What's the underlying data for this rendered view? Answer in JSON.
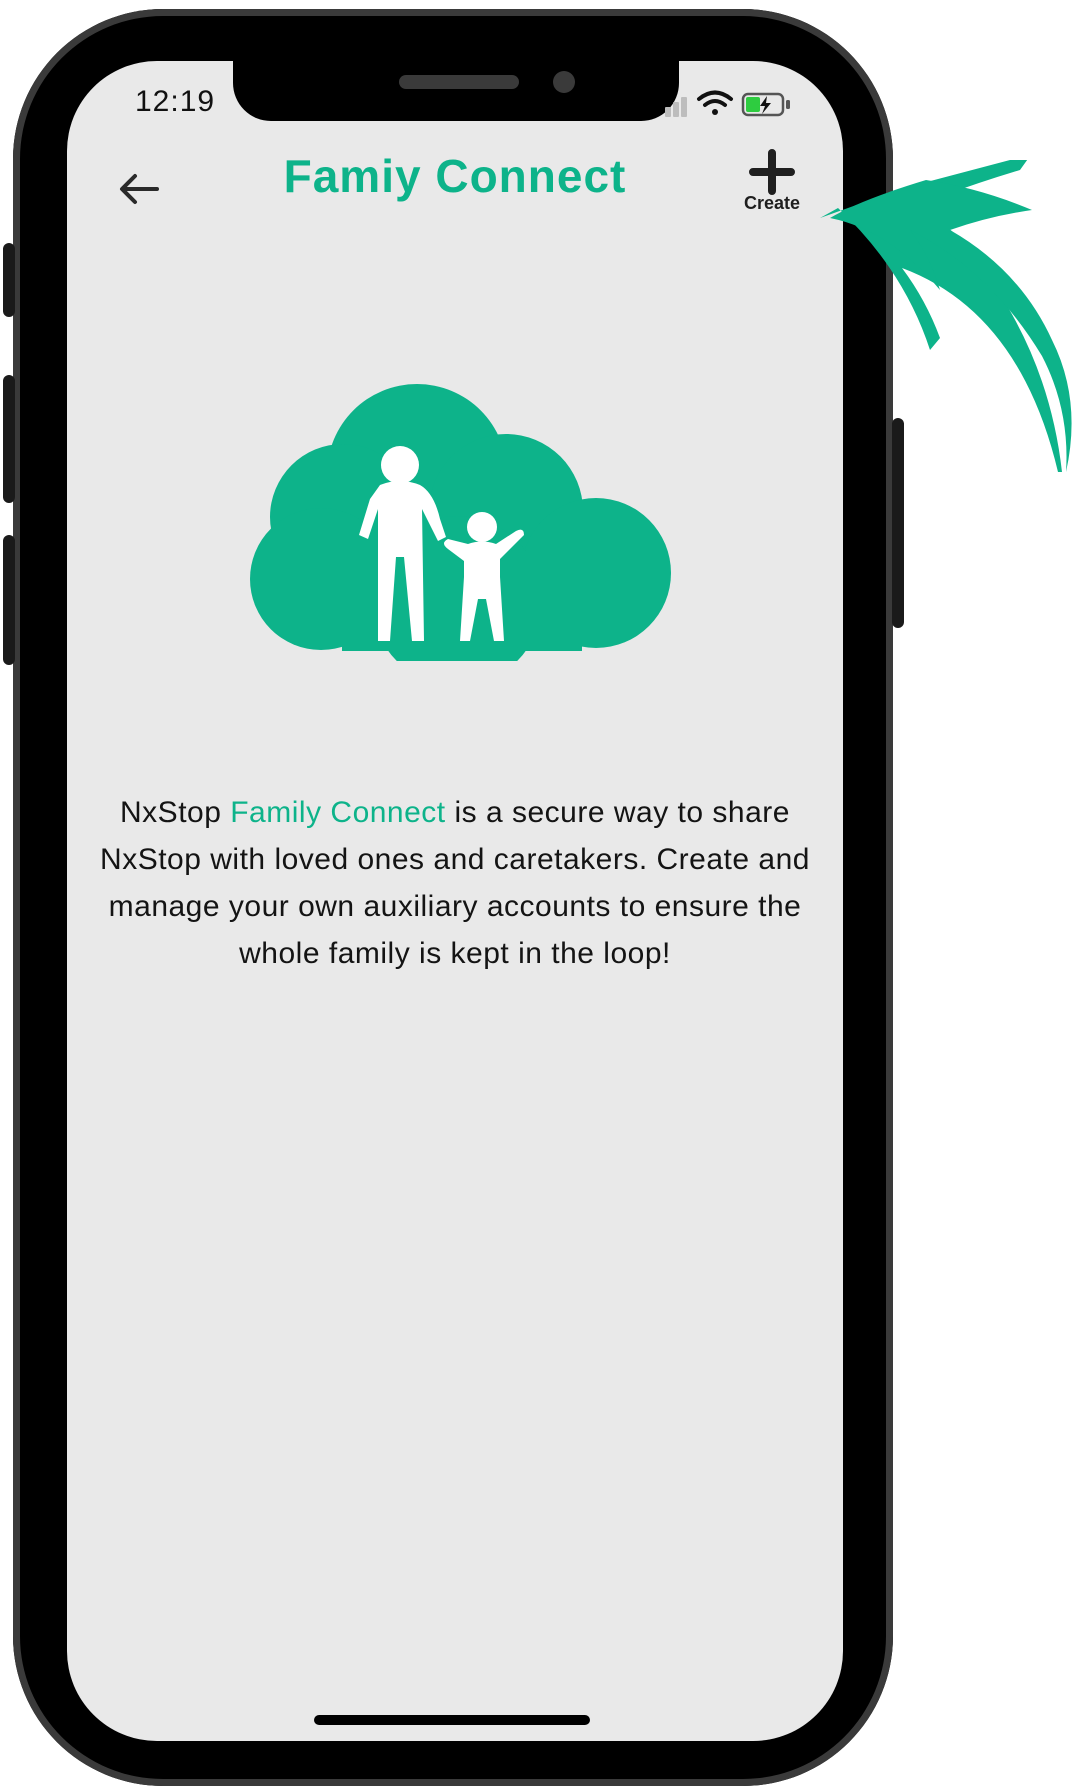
{
  "status_bar": {
    "time": "12:19",
    "icons": [
      "signal-icon",
      "wifi-icon",
      "battery-charging-icon"
    ]
  },
  "header": {
    "back_icon": "arrow-left-icon",
    "title": "Famiy Connect",
    "create_icon": "plus-icon",
    "create_label": "Create"
  },
  "hero": {
    "icon": "parent-child-cloud-icon"
  },
  "description": {
    "prefix": "NxStop ",
    "highlight": "Family Connect",
    "suffix": " is a secure way to share NxStop with loved ones and caretakers. Create and manage your own auxiliary accounts to ensure the whole family is kept in the loop!"
  },
  "annotation": {
    "icon": "curved-arrow-icon"
  },
  "colors": {
    "accent": "#0db38a",
    "screen_bg": "#e9e9e9",
    "text": "#141414",
    "frame": "#000000"
  }
}
